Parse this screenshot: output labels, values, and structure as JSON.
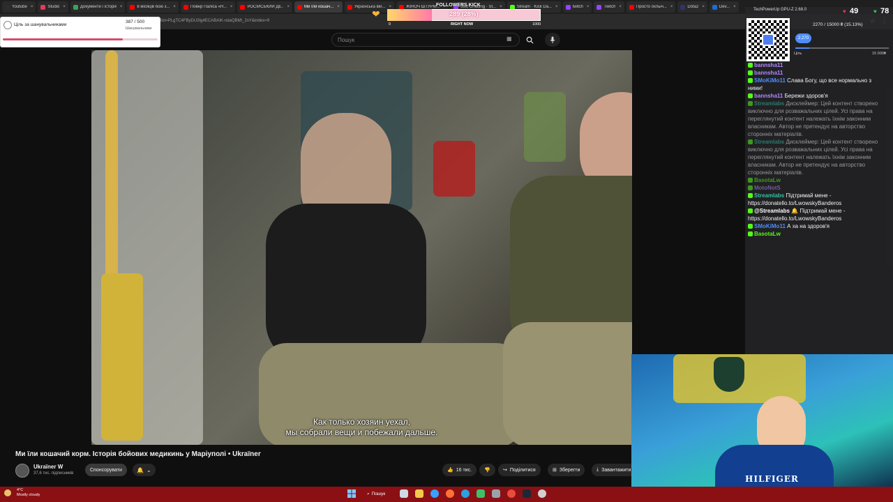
{
  "browser": {
    "tabs": [
      {
        "label": "Youtube",
        "color": "#2d2d2d"
      },
      {
        "label": "Studio",
        "color": "#e5395a"
      },
      {
        "label": "Документи і історія",
        "color": "#39a35b"
      },
      {
        "label": "8 місяців бою з...",
        "color": "#ff0000"
      },
      {
        "label": "Повнр Паліса «Н...",
        "color": "#ff0000"
      },
      {
        "label": "РОСІЙСЬКИЙ ДЕ...",
        "color": "#ff0000"
      },
      {
        "label": "Ми їли кошач...",
        "color": "#ff0000",
        "active": true
      },
      {
        "label": "Українська вій...",
        "color": "#ff0000"
      },
      {
        "label": "ЖІНОЧ ШТУРМ...",
        "color": "#ff0000"
      },
      {
        "label": "Just Chatting · St...",
        "color": "#9146ff"
      },
      {
        "label": "Stream · Kick Da...",
        "color": "#53fc18"
      },
      {
        "label": "twitch",
        "color": "#9146ff"
      },
      {
        "label": "Twitch",
        "color": "#9146ff"
      },
      {
        "label": "Просто охлыч...",
        "color": "#ff0000"
      },
      {
        "label": "Dota2",
        "color": "#333366"
      },
      {
        "label": "Dev...",
        "color": "#1c6dd0"
      }
    ],
    "url": "list=PLgTC4FByDU3Ig4ECABAIK-ndaQBMt_2sY&index=9",
    "actions": [
      "☆",
      "⋮"
    ]
  },
  "youtube": {
    "search_placeholder": "Пошук",
    "search_icon": "search-icon",
    "mic_icon": "mic-icon",
    "subtitle_line1": "Как только хозяин уехал,",
    "subtitle_line2": "мы собрали вещи и побежали дальше.",
    "video_title": "Ми їли кошачий корм. Історія бойових медикинь у Маріуполі • Ukraїner",
    "channel_name": "Ukraїner W",
    "channel_subs": "37,6 тис. підписників",
    "sponsor_label": "Спонсорувати",
    "likes": "16 тис.",
    "share_label": "Поділитися",
    "save_label": "Зберегти",
    "download_label": "Завантажити"
  },
  "goal_widget": {
    "title": "Ціль за шанувальниками",
    "count": "387 / 500",
    "label": "Шанувальники",
    "progress": 0.774
  },
  "followers_kick": {
    "label": "FOLLOWERS KICK",
    "value": "289 (28%)",
    "progress": 0.289,
    "min": "0",
    "mid": "RIGHT NOW",
    "max": "1000"
  },
  "overlay": {
    "gpu_title": "TechPowerUp GPU-Z 2.68.0",
    "count_left": "49",
    "count_right": "78",
    "donation_text": "2270 / 15000 ₴ (15.13%)",
    "donation_badge": "2.270",
    "donation_progress": 0.1513,
    "donation_label": "Ціль",
    "donation_max": "15 000₴"
  },
  "chat": [
    {
      "name": "bannsha11",
      "color": "#b388ff",
      "message": ""
    },
    {
      "name": "bannsha11",
      "color": "#b388ff",
      "message": ""
    },
    {
      "name": "SMoKiMo11",
      "color": "#4f8ef7",
      "message": "Слава Богу, що все нормально з ними!"
    },
    {
      "name": "bannsha11",
      "color": "#b388ff",
      "message": "Бережи здоров'я"
    },
    {
      "name": "Streamlabs",
      "color": "#31c3a2",
      "message": "Дисклеймер: Цей контент створено виключно для розважальних цілей. Усі права на переглянутий контент належать їхнім законним власникам. Автор не претендує на авторство сторонніх матеріалів."
    },
    {
      "name": "Streamlabs",
      "color": "#31c3a2",
      "message": "Дисклеймер: Цей контент створено виключно для розважальних цілей. Усі права на переглянутий контент належать їхнім законним власникам. Автор не претендує на авторство сторонніх матеріалів."
    },
    {
      "name": "BasotaLw",
      "color": "#53fc18",
      "message": ""
    },
    {
      "name": "MotoNotS",
      "color": "#b388ff",
      "message": ""
    },
    {
      "name": "Streamlabs",
      "color": "#31c3a2",
      "message": "Підтримай мене - https://donatello.to/LwowskyBanderos"
    },
    {
      "name": "@Streamlabs",
      "color": "#ffffff",
      "message": "🔔 Підтримай мене - https://donatello.to/LwowskyBanderos"
    },
    {
      "name": "SMoKiMo11",
      "color": "#4f8ef7",
      "message": "А ха на здоров'я"
    },
    {
      "name": "BasotaLw",
      "color": "#53fc18",
      "message": ""
    }
  ],
  "taskbar": {
    "weather_temp": "4°C",
    "weather_desc": "Mostly cloudy",
    "search_label": "Пошук"
  },
  "webcam": {
    "shirt_text": "HILFIGER"
  },
  "colors": {
    "accent_red": "#d64b6b",
    "taskbar": "#8a1014",
    "kick_green": "#53fc18"
  }
}
